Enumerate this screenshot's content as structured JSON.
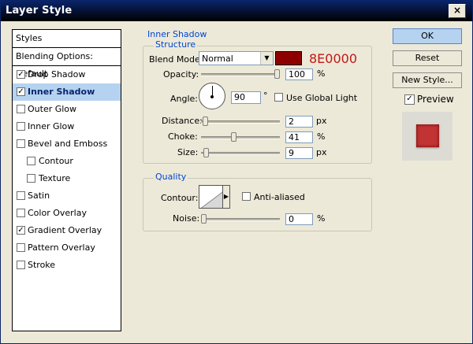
{
  "window": {
    "title": "Layer Style",
    "close_glyph": "×"
  },
  "styles_panel": {
    "header": "Styles",
    "blending_options": "Blending Options: Default",
    "items": [
      {
        "label": "Drop Shadow",
        "checked": true,
        "indent": false,
        "selected": false
      },
      {
        "label": "Inner Shadow",
        "checked": true,
        "indent": false,
        "selected": true
      },
      {
        "label": "Outer Glow",
        "checked": false,
        "indent": false,
        "selected": false
      },
      {
        "label": "Inner Glow",
        "checked": false,
        "indent": false,
        "selected": false
      },
      {
        "label": "Bevel and Emboss",
        "checked": false,
        "indent": false,
        "selected": false
      },
      {
        "label": "Contour",
        "checked": false,
        "indent": true,
        "selected": false
      },
      {
        "label": "Texture",
        "checked": false,
        "indent": true,
        "selected": false
      },
      {
        "label": "Satin",
        "checked": false,
        "indent": false,
        "selected": false
      },
      {
        "label": "Color Overlay",
        "checked": false,
        "indent": false,
        "selected": false
      },
      {
        "label": "Gradient Overlay",
        "checked": true,
        "indent": false,
        "selected": false
      },
      {
        "label": "Pattern Overlay",
        "checked": false,
        "indent": false,
        "selected": false
      },
      {
        "label": "Stroke",
        "checked": false,
        "indent": false,
        "selected": false
      }
    ]
  },
  "structure": {
    "section_title": "Inner Shadow",
    "group_title": "Structure",
    "blend_mode_label": "Blend Mode:",
    "blend_mode_value": "Normal",
    "color_hex": "8E0000",
    "color_value": "#8e0000",
    "opacity_label": "Opacity:",
    "opacity_value": "100",
    "opacity_fraction": 1.0,
    "opacity_unit": "%",
    "angle_label": "Angle:",
    "angle_value": "90",
    "angle_unit": "°",
    "use_global_light_label": "Use Global Light",
    "use_global_light_checked": false,
    "distance_label": "Distance:",
    "distance_value": "2",
    "distance_fraction": 0.02,
    "distance_unit": "px",
    "choke_label": "Choke:",
    "choke_value": "41",
    "choke_fraction": 0.41,
    "choke_unit": "%",
    "size_label": "Size:",
    "size_value": "9",
    "size_fraction": 0.036,
    "size_unit": "px"
  },
  "quality": {
    "group_title": "Quality",
    "contour_label": "Contour:",
    "anti_aliased_label": "Anti-aliased",
    "anti_aliased_checked": false,
    "noise_label": "Noise:",
    "noise_value": "0",
    "noise_fraction": 0.0,
    "noise_unit": "%"
  },
  "buttons": {
    "ok": "OK",
    "reset": "Reset",
    "new_style": "New Style...",
    "preview_label": "Preview",
    "preview_checked": true
  },
  "icons": {
    "dropdown_arrow": "▼",
    "contour_arrow": "▶"
  }
}
